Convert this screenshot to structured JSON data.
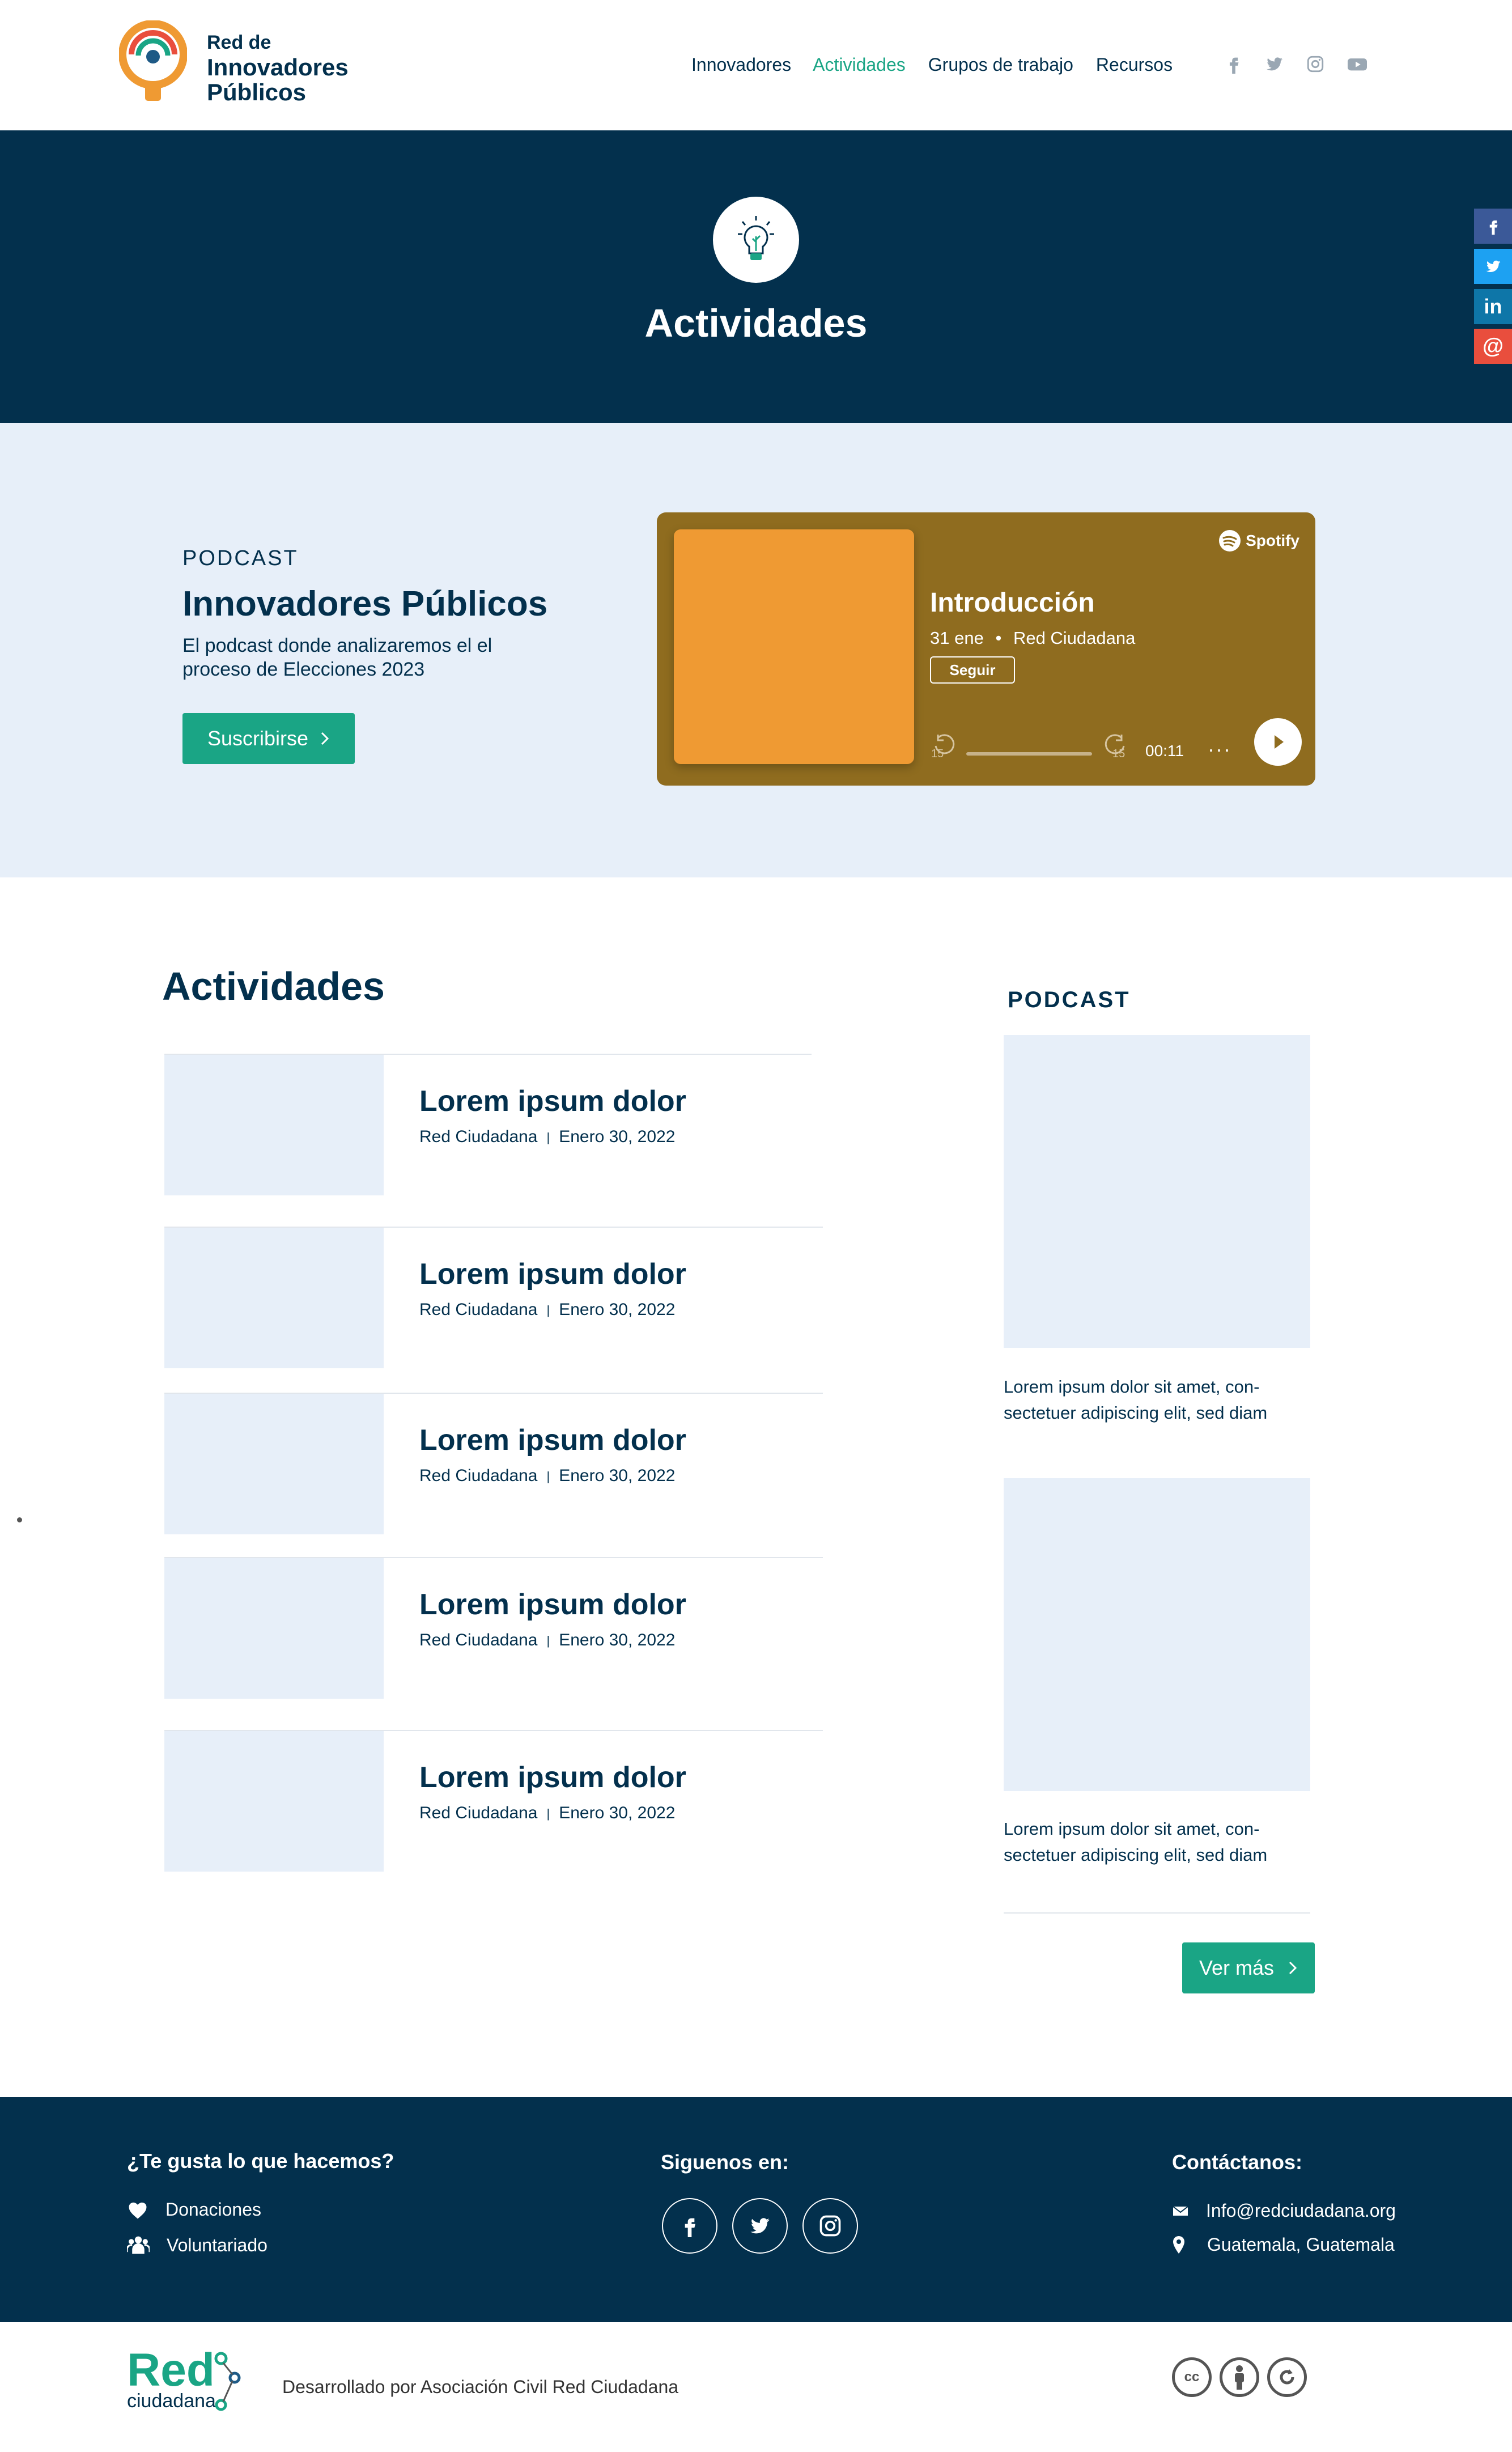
{
  "header": {
    "logo": {
      "line1": "Red de",
      "line2": "Innovadores",
      "line3": "Públicos"
    },
    "nav": [
      {
        "label": "Innovadores",
        "active": false
      },
      {
        "label": "Actividades",
        "active": true
      },
      {
        "label": "Grupos de trabajo",
        "active": false
      },
      {
        "label": "Recursos",
        "active": false
      }
    ],
    "social_icons": [
      "facebook-icon",
      "twitter-icon",
      "instagram-icon",
      "youtube-icon"
    ]
  },
  "hero": {
    "title": "Actividades",
    "icon": "lightbulb-icon"
  },
  "share_bar": [
    "facebook-icon",
    "twitter-icon",
    "linkedin-icon",
    "email-icon"
  ],
  "podcast": {
    "kicker": "PODCAST",
    "title": "Innovadores Públicos",
    "description": "El podcast donde analizaremos el el proceso de Elecciones 2023",
    "button": "Suscribirse",
    "player": {
      "brand": "Spotify",
      "episode_title": "Introducción",
      "date": "31 ene",
      "show": "Red Ciudadana",
      "follow": "Seguir",
      "skip_back": "15",
      "skip_forward": "15",
      "time": "00:11",
      "more": "···"
    }
  },
  "activities": {
    "title": "Actividades",
    "items": [
      {
        "title": "Lorem ipsum dolor",
        "author": "Red Ciudadana",
        "date": "Enero 30, 2022"
      },
      {
        "title": "Lorem ipsum dolor",
        "author": "Red Ciudadana",
        "date": "Enero 30, 2022"
      },
      {
        "title": "Lorem ipsum dolor",
        "author": "Red Ciudadana",
        "date": "Enero 30, 2022"
      },
      {
        "title": "Lorem ipsum dolor",
        "author": "Red Ciudadana",
        "date": "Enero 30, 2022"
      },
      {
        "title": "Lorem ipsum dolor",
        "author": "Red Ciudadana",
        "date": "Enero 30, 2022"
      }
    ]
  },
  "sidebar": {
    "kicker": "PODCAST",
    "cards": [
      {
        "line1": "Lorem ipsum dolor sit amet, con-",
        "line2": "sectetuer adipiscing elit, sed diam"
      },
      {
        "line1": "Lorem ipsum dolor sit amet, con-",
        "line2": "sectetuer adipiscing elit, sed diam"
      }
    ],
    "more_button": "Ver más"
  },
  "footer": {
    "col1": {
      "title": "¿Te gusta lo que hacemos?",
      "items": [
        "Donaciones",
        "Voluntariado"
      ]
    },
    "col2": {
      "title": "Siguenos en:"
    },
    "col3": {
      "title": "Contáctanos:",
      "email": "Info@redciudadana.org",
      "location": "Guatemala, Guatemala"
    },
    "brand": {
      "main": "Red",
      "sub": "ciudadana"
    },
    "developed_by": "Desarrollado por Asociación Civil Red Ciudadana",
    "license_icons": [
      "cc-icon",
      "by-icon",
      "sa-icon"
    ]
  },
  "colors": {
    "navy": "#03304d",
    "green": "#1aa585",
    "light_blue": "#e7eff9",
    "orange": "#ef9a33",
    "player_bg": "#8f6c1f"
  }
}
